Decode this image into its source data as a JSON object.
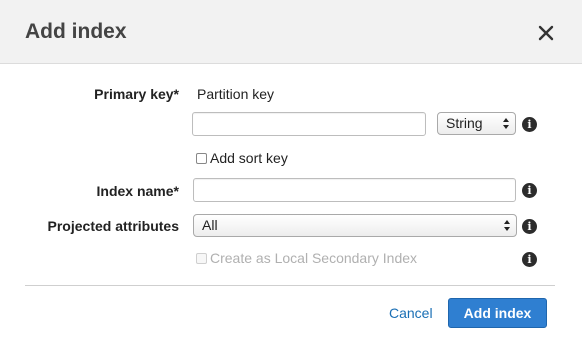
{
  "dialog": {
    "title": "Add index",
    "close_icon": "close-icon"
  },
  "form": {
    "primary_key": {
      "label": "Primary key*",
      "sub_label": "Partition key",
      "value": "",
      "type_value": "String"
    },
    "sort_key": {
      "label": "Add sort key",
      "checked": false
    },
    "index_name": {
      "label": "Index name*",
      "value": ""
    },
    "projected_attributes": {
      "label": "Projected attributes",
      "value": "All"
    },
    "lsi": {
      "label": "Create as Local Secondary Index",
      "checked": false,
      "disabled": true
    },
    "info_icon": "info-icon"
  },
  "footer": {
    "cancel_label": "Cancel",
    "submit_label": "Add index"
  },
  "colors": {
    "accent": "#2f7fd1",
    "link": "#1a6fb5",
    "header_bg": "#f2f2f2"
  }
}
